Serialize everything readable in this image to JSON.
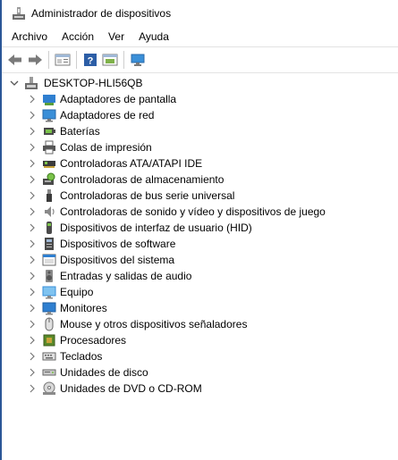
{
  "window": {
    "title": "Administrador de dispositivos"
  },
  "menu": [
    "Archivo",
    "Acción",
    "Ver",
    "Ayuda"
  ],
  "toolbar": {
    "buttons": [
      "back-icon",
      "forward-icon",
      "properties-icon",
      "help-icon",
      "console-icon",
      "scan-hardware-icon"
    ]
  },
  "tree": {
    "root": "DESKTOP-HLI56QB",
    "items": [
      {
        "label": "Adaptadores de pantalla",
        "icon": "display-adapter-icon"
      },
      {
        "label": "Adaptadores de red",
        "icon": "network-adapter-icon"
      },
      {
        "label": "Baterías",
        "icon": "battery-icon"
      },
      {
        "label": "Colas de impresión",
        "icon": "printer-icon"
      },
      {
        "label": "Controladoras ATA/ATAPI IDE",
        "icon": "ide-controller-icon"
      },
      {
        "label": "Controladoras de almacenamiento",
        "icon": "storage-controller-icon"
      },
      {
        "label": "Controladoras de bus serie universal",
        "icon": "usb-icon"
      },
      {
        "label": "Controladoras de sonido y vídeo y dispositivos de juego",
        "icon": "sound-icon"
      },
      {
        "label": "Dispositivos de interfaz de usuario (HID)",
        "icon": "hid-icon"
      },
      {
        "label": "Dispositivos de software",
        "icon": "software-device-icon"
      },
      {
        "label": "Dispositivos del sistema",
        "icon": "system-device-icon"
      },
      {
        "label": "Entradas y salidas de audio",
        "icon": "audio-io-icon"
      },
      {
        "label": "Equipo",
        "icon": "computer-icon"
      },
      {
        "label": "Monitores",
        "icon": "monitor-icon"
      },
      {
        "label": "Mouse y otros dispositivos señaladores",
        "icon": "mouse-icon"
      },
      {
        "label": "Procesadores",
        "icon": "processor-icon"
      },
      {
        "label": "Teclados",
        "icon": "keyboard-icon"
      },
      {
        "label": "Unidades de disco",
        "icon": "disk-drive-icon"
      },
      {
        "label": "Unidades de DVD o CD-ROM",
        "icon": "dvd-drive-icon"
      }
    ]
  }
}
